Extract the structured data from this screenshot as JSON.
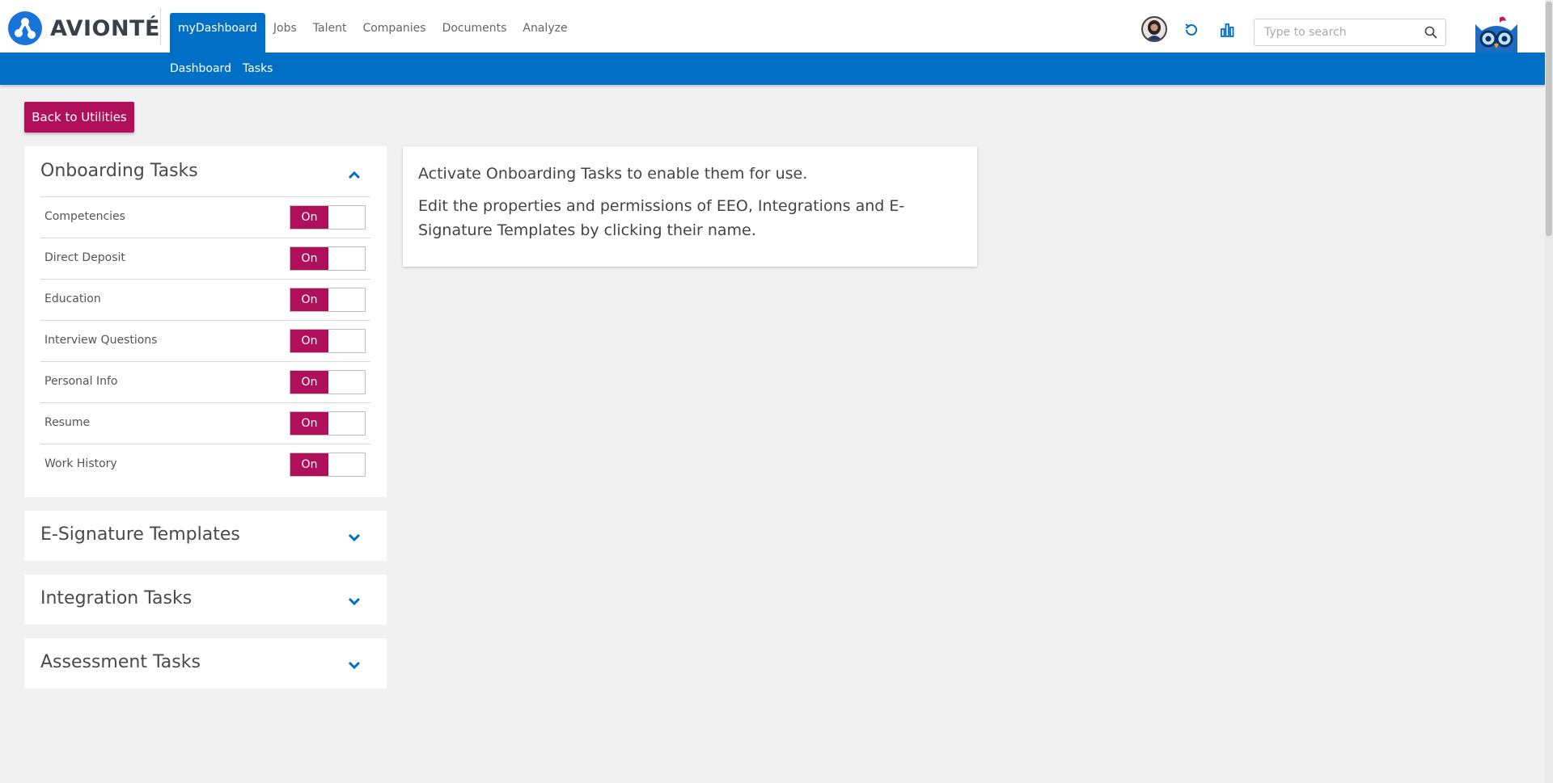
{
  "brand": {
    "logo_text": "AVIONTÉ",
    "accent": "#0070c6",
    "primary": "#b0105b"
  },
  "mainnav": {
    "items": [
      {
        "label": "myDashboard",
        "active": true
      },
      {
        "label": "Jobs"
      },
      {
        "label": "Talent"
      },
      {
        "label": "Companies"
      },
      {
        "label": "Documents"
      },
      {
        "label": "Analyze"
      }
    ]
  },
  "header": {
    "icons": [
      "avatar",
      "refresh-icon",
      "chart-icon",
      "owl-mascot"
    ],
    "search": {
      "placeholder": "Type to search",
      "value": ""
    }
  },
  "subnav": {
    "items": [
      {
        "label": "Dashboard"
      },
      {
        "label": "Tasks"
      }
    ]
  },
  "back_button": {
    "label": "Back to Utilities"
  },
  "onboarding": {
    "title": "Onboarding Tasks",
    "expanded": true,
    "tasks": [
      {
        "label": "Competencies",
        "toggle": "On"
      },
      {
        "label": "Direct Deposit",
        "toggle": "On"
      },
      {
        "label": "Education",
        "toggle": "On"
      },
      {
        "label": "Interview Questions",
        "toggle": "On"
      },
      {
        "label": "Personal Info",
        "toggle": "On"
      },
      {
        "label": "Resume",
        "toggle": "On"
      },
      {
        "label": "Work History",
        "toggle": "On"
      }
    ]
  },
  "collapsed_panels": {
    "esignature": {
      "title": "E-Signature Templates",
      "expanded": false
    },
    "integration": {
      "title": "Integration Tasks",
      "expanded": false
    },
    "assessment": {
      "title": "Assessment Tasks",
      "expanded": false
    }
  },
  "info": {
    "line1": "Activate Onboarding Tasks to enable them for use.",
    "line2": "Edit the properties and permissions of EEO, Integrations and E-Signature Templates by clicking their name."
  }
}
